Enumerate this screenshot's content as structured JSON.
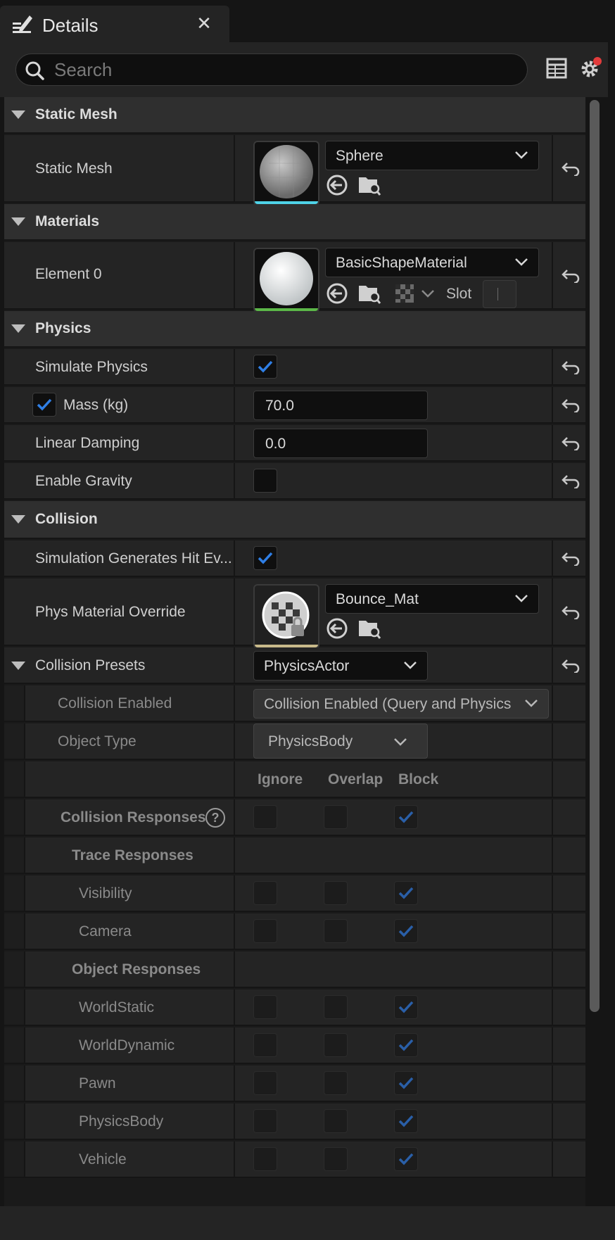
{
  "tab": {
    "title": "Details",
    "close_glyph": "✕"
  },
  "search": {
    "placeholder": "Search",
    "value": ""
  },
  "static_mesh_section": {
    "label": "Static Mesh",
    "property": {
      "label": "Static Mesh",
      "value": "Sphere"
    }
  },
  "materials_section": {
    "label": "Materials",
    "element0": {
      "label": "Element 0",
      "value": "BasicShapeMaterial",
      "slot_label": "Slot"
    }
  },
  "physics_section": {
    "label": "Physics",
    "simulate_physics": {
      "label": "Simulate Physics",
      "checked": true
    },
    "mass": {
      "label": "Mass (kg)",
      "value": "70.0",
      "override_checked": true
    },
    "linear_damping": {
      "label": "Linear Damping",
      "value": "0.0"
    },
    "enable_gravity": {
      "label": "Enable Gravity",
      "checked": false
    }
  },
  "collision_section": {
    "label": "Collision",
    "sim_hit_events": {
      "label": "Simulation Generates Hit Ev...",
      "checked": true
    },
    "phys_material_override": {
      "label": "Phys Material Override",
      "value": "Bounce_Mat"
    },
    "collision_presets": {
      "label": "Collision Presets",
      "value": "PhysicsActor"
    },
    "collision_enabled": {
      "label": "Collision Enabled",
      "value": "Collision Enabled (Query and Physics"
    },
    "object_type": {
      "label": "Object Type",
      "value": "PhysicsBody"
    },
    "response_headers": [
      "Ignore",
      "Overlap",
      "Block"
    ],
    "collision_responses": {
      "label": "Collision Responses",
      "help_glyph": "?"
    },
    "trace_responses": {
      "label": "Trace Responses",
      "items": [
        {
          "label": "Visibility",
          "response": "Block"
        },
        {
          "label": "Camera",
          "response": "Block"
        }
      ]
    },
    "object_responses": {
      "label": "Object Responses",
      "items": [
        {
          "label": "WorldStatic",
          "response": "Block"
        },
        {
          "label": "WorldDynamic",
          "response": "Block"
        },
        {
          "label": "Pawn",
          "response": "Block"
        },
        {
          "label": "PhysicsBody",
          "response": "Block"
        },
        {
          "label": "Vehicle",
          "response": "Block"
        }
      ]
    }
  },
  "colors": {
    "accent_check": "#2f7fe6",
    "mesh_bar": "#4fd3e8",
    "material_bar": "#5cb848",
    "physmat_bar": "#c8b98a",
    "notify_dot": "#e23c3c"
  }
}
